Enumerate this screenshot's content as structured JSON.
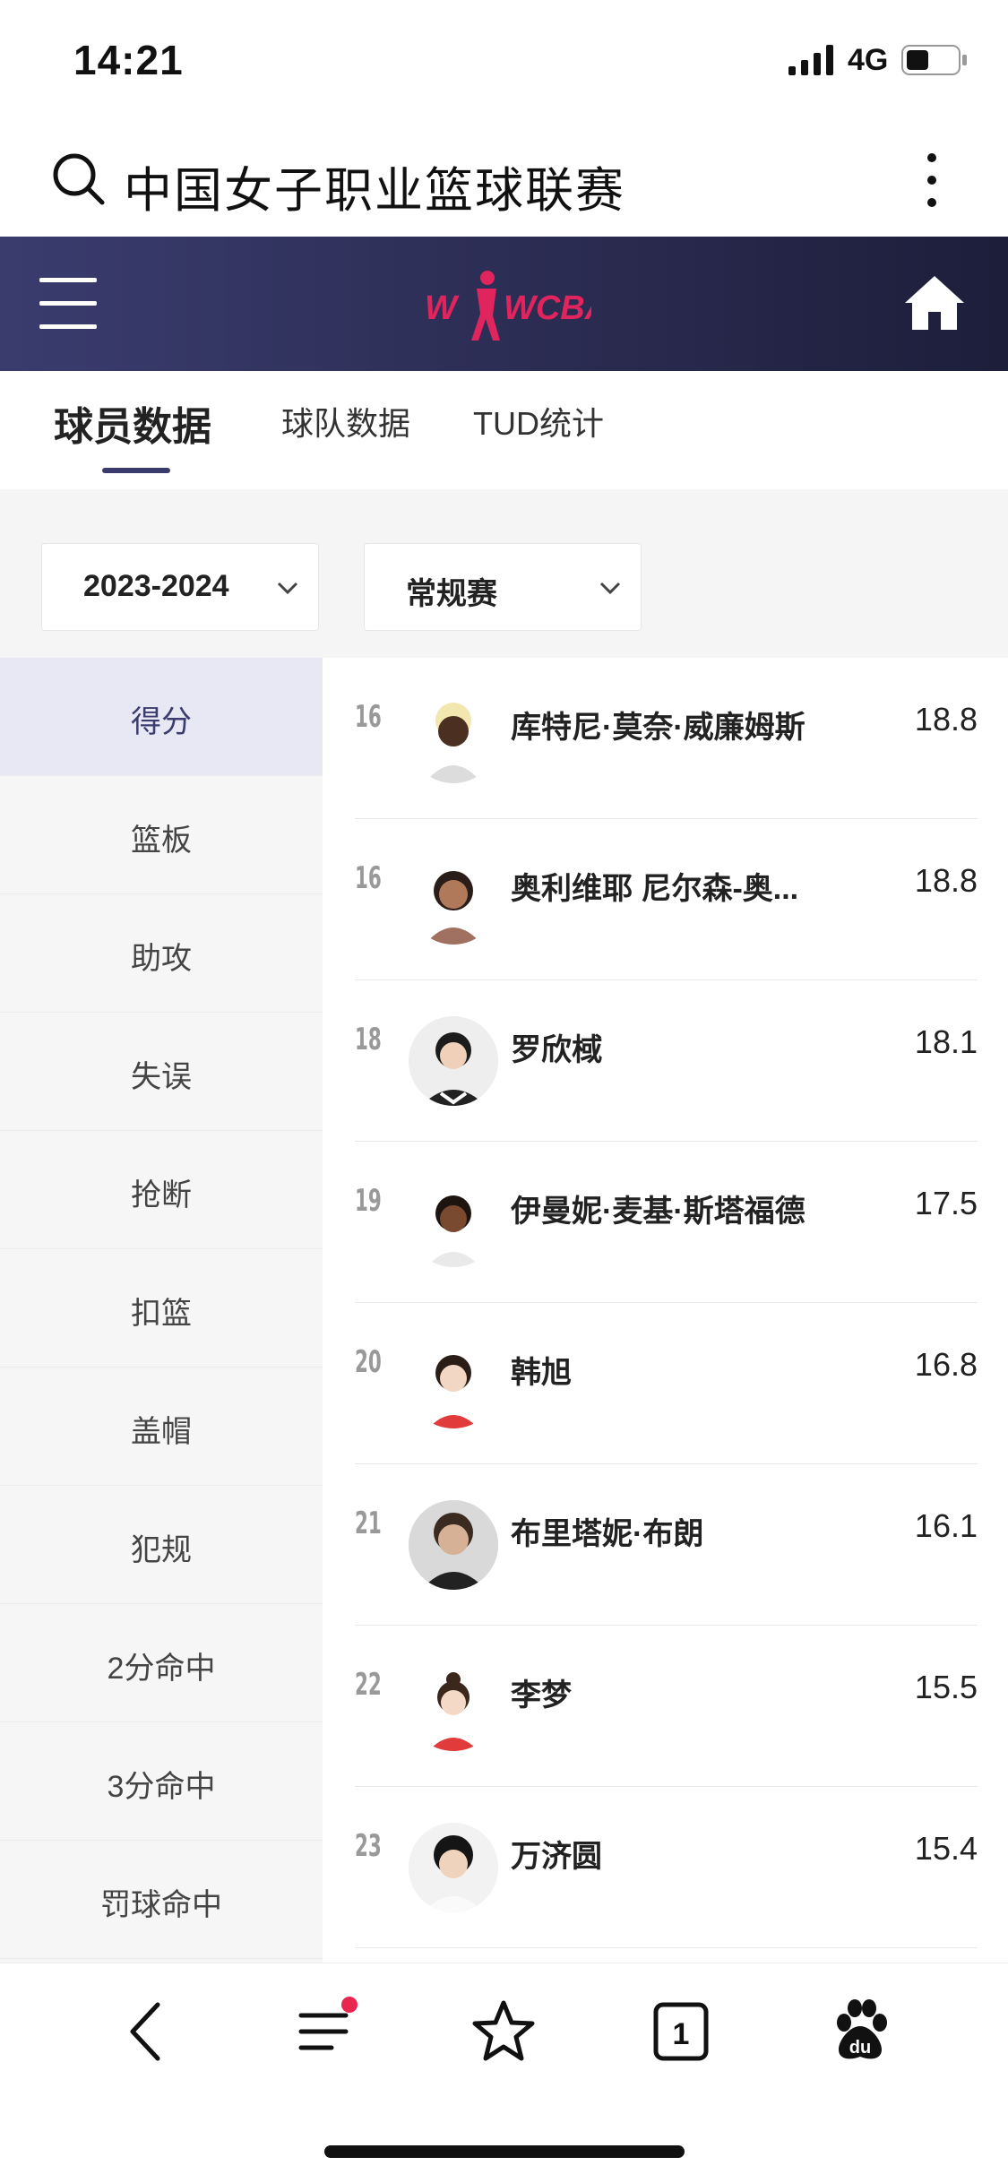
{
  "status_bar": {
    "time": "14:21",
    "network": "4G"
  },
  "search": {
    "text": "中国女子职业篮球联赛"
  },
  "header": {
    "logo_text": "WCBA"
  },
  "tabs": [
    {
      "label": "球员数据",
      "active": true
    },
    {
      "label": "球队数据",
      "active": false
    },
    {
      "label": "TUD统计",
      "active": false
    }
  ],
  "filters": {
    "season": "2023-2024",
    "stage": "常规赛"
  },
  "categories": [
    {
      "label": "得分",
      "active": true
    },
    {
      "label": "篮板"
    },
    {
      "label": "助攻"
    },
    {
      "label": "失误"
    },
    {
      "label": "抢断"
    },
    {
      "label": "扣篮"
    },
    {
      "label": "盖帽"
    },
    {
      "label": "犯规"
    },
    {
      "label": "2分命中"
    },
    {
      "label": "3分命中"
    },
    {
      "label": "罚球命中"
    }
  ],
  "players": [
    {
      "rank": "16",
      "name": "库特尼·莫奈·威廉姆斯",
      "value": "18.8"
    },
    {
      "rank": "16",
      "name": "奥利维耶 尼尔森-奥...",
      "value": "18.8"
    },
    {
      "rank": "18",
      "name": "罗欣棫",
      "value": "18.1"
    },
    {
      "rank": "19",
      "name": "伊曼妮·麦基·斯塔福德",
      "value": "17.5"
    },
    {
      "rank": "20",
      "name": "韩旭",
      "value": "16.8"
    },
    {
      "rank": "21",
      "name": "布里塔妮·布朗",
      "value": "16.1"
    },
    {
      "rank": "22",
      "name": "李梦",
      "value": "15.5"
    },
    {
      "rank": "23",
      "name": "万济圆",
      "value": "15.4"
    }
  ],
  "colors": {
    "header_navy": "#2b2c52",
    "accent_pink": "#e0245e",
    "active_category_bg": "#e7e8f4",
    "notification_dot": "#e8264e"
  },
  "icons": [
    "search-icon",
    "more-vertical-icon",
    "menu-icon",
    "home-icon",
    "back-icon",
    "feed-icon",
    "star-icon",
    "tabs-icon",
    "baidu-paw-icon"
  ],
  "toolbar": {
    "tab_count": "1"
  }
}
